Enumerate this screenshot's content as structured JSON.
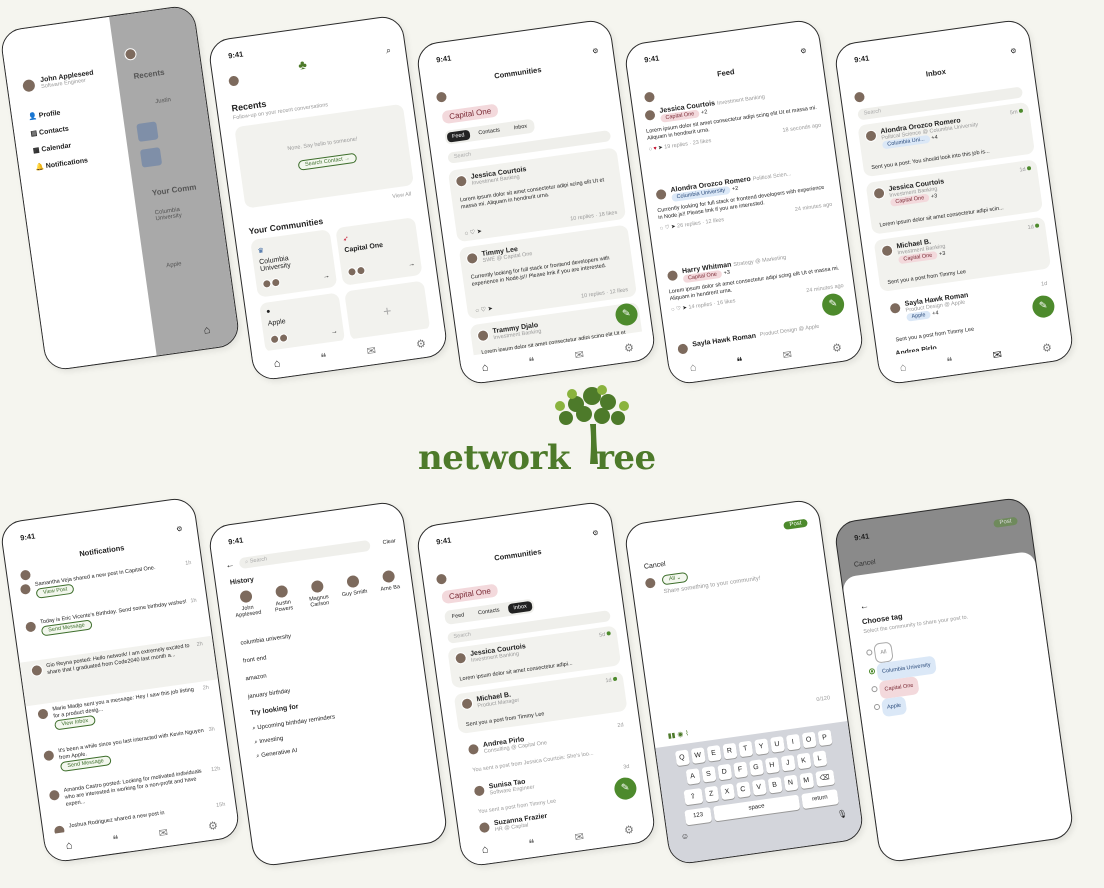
{
  "time": "9:41",
  "brand": {
    "name_left": "network",
    "name_right": "ree",
    "accent": "#4d7a2a"
  },
  "menu": {
    "user": "John Appleseed",
    "role": "Software Engineer",
    "items": [
      "Profile",
      "Contacts",
      "Calendar",
      "Notifications"
    ],
    "behind": [
      "Recents",
      "Justin",
      "Your Comm",
      "Columbia University",
      "Apple"
    ]
  },
  "home": {
    "recents_title": "Recents",
    "recents_sub": "Follow-up on your recent conversations",
    "empty_text": "None. Say hello to someone!",
    "search_contact": "Search Contact →",
    "communities_title": "Your Communities",
    "view_all": "View All",
    "communities": [
      "Columbia University",
      "Capital One",
      "Apple"
    ],
    "plus": "+"
  },
  "community_feed": {
    "title": "Communities",
    "chip": "Capital One",
    "tabs": [
      "Feed",
      "Contacts",
      "Inbox"
    ],
    "search": "Search",
    "filter": "Filter",
    "posts": [
      {
        "name": "Jessica Courtois",
        "role": "Investment Banking",
        "body": "Lorem ipsum dolor sit amet consectetur adipi scing elit Ut et massa mi. Aliquam in hendrerit urna.",
        "meta": "10 replies · 18 likes"
      },
      {
        "name": "Timmy Lee",
        "role": "SWE @ Capital One",
        "body": "Currently looking for full stack or frontend developers with experience in Node.js!! Please lmk if you are interested.",
        "meta": "10 replies · 12 likes"
      },
      {
        "name": "Trammy Djalo",
        "role": "Investment Banking",
        "body": "Lorem ipsum dolor sit amet consectetur adipi scing elit Ut et massa mi. Aliquam in hendrerit"
      }
    ]
  },
  "feed": {
    "title": "Feed",
    "posts": [
      {
        "name": "Jessica Courtois",
        "role": "Investment Banking",
        "tag": "Capital One",
        "more": "+2",
        "body": "Lorem ipsum dolor sit amet consectetur adipi scing elit Ut et massa mi. Aliquam in hendrerit urna.",
        "meta": "19 replies · 23 likes",
        "time": "18 seconds ago"
      },
      {
        "name": "Alondra Orozco Romero",
        "role": "Political Scien...",
        "tag": "Columbia University",
        "more": "+2",
        "body": "Currently looking for full stack or frontend developers with experience in Node.js!! Please lmk if you are interested.",
        "meta": "26 replies · 12 likes",
        "time": "24 minutes ago"
      },
      {
        "name": "Harry Whitman",
        "role": "Strategy @ Marketing",
        "tag": "Capital One",
        "more": "+3",
        "body": "Lorem ipsum dolor sit amet consectetur adipi scing elit Ut et massa mi. Aliquam in hendrerit urna.",
        "meta": "14 replies · 16 likes",
        "time": "24 minutes ago"
      },
      {
        "name": "Sayla Hawk Roman",
        "role": "Product Design @ Apple"
      }
    ]
  },
  "inbox": {
    "title": "Inbox",
    "search": "Search",
    "items": [
      {
        "name": "Alondra Orozco Romero",
        "role": "Political Science @ Columbia University",
        "tag": "Columbia Uni...",
        "more": "+4",
        "msg": "Sent you a post: You should look into this job is...",
        "time": "5m"
      },
      {
        "name": "Jessica Courtois",
        "role": "Investment Banking",
        "tag": "Capital One",
        "more": "+3",
        "msg": "Lorem ipsum dolor sit amet consectetur adipi scin...",
        "time": "1d"
      },
      {
        "name": "Michael B.",
        "role": "Investment Banking",
        "tag": "Capital One",
        "more": "+3",
        "msg": "Sent you a post from Timmy Lee",
        "time": "1d"
      },
      {
        "name": "Sayla Hawk Roman",
        "role": "Product Design @ Apple",
        "tag": "Apple",
        "more": "+4",
        "msg": "Sent you a post from Timmy Lee",
        "time": "1d"
      },
      {
        "name": "Andrea Pirlo"
      }
    ]
  },
  "notifications": {
    "title": "Notifications",
    "items": [
      {
        "text": "Samantha Veja shared a new post in Capital One.",
        "btn": "View Post",
        "time": "1h"
      },
      {
        "text": "Today is Eric Vicente's Birthday. Send some birthday wishes!",
        "btn": "Send Message",
        "time": "1h"
      },
      {
        "text": "Gio Reyna posted: Hello network! I am extremely excited to share that I graduated from Code2040 last month a...",
        "time": "2h"
      },
      {
        "text": "Marie Madjo sent you a message: Hey I saw this job listing for a product desig...",
        "btn": "View Inbox",
        "time": "2h"
      },
      {
        "text": "It's been a while since you last interacted with Kevin Nguyen from Apple.",
        "btn": "Send Message",
        "time": "3h"
      },
      {
        "text": "Amanda Castro posted: Looking for motivated individuals who are interested in working for a non-profit and have experi...",
        "time": "12h"
      },
      {
        "text": "Joshua Rodriguez shared a new post in",
        "time": "15h"
      }
    ]
  },
  "search_screen": {
    "placeholder": "Search",
    "clear": "Clear",
    "history_title": "History",
    "people": [
      "John Appleseed",
      "Austin Powers",
      "Magnus Carlson",
      "Guy Smith",
      "Ame Ba"
    ],
    "history": [
      "columbia university",
      "front end",
      "amazon",
      "january birthday"
    ],
    "try_title": "Try looking for",
    "suggestions": [
      "Upcoming birthday reminders",
      "Investing",
      "Generative AI"
    ]
  },
  "community_inbox": {
    "title": "Communities",
    "chip": "Capital One",
    "tabs": [
      "Feed",
      "Contacts",
      "Inbox"
    ],
    "search": "Search",
    "items": [
      {
        "name": "Jessica Courtois",
        "role": "Investment Banking",
        "msg": "Lorem ipsum dolor sit amet consectetur adipi...",
        "time": "5d"
      },
      {
        "name": "Michael B.",
        "role": "Product Manager",
        "msg": "Sent you a post from Timmy Lee",
        "time": "1d"
      },
      {
        "name": "Andrea Pirlo",
        "role": "Consulting @ Capital One",
        "msg": "You sent a post from Jessica Courtois: She's loo...",
        "time": "2d"
      },
      {
        "name": "Sunisa Tao",
        "role": "Software Engineer",
        "msg": "You sent a post from Timmy Lee",
        "time": "3d"
      },
      {
        "name": "Suzanna Frazier",
        "role": "HR @ Capital"
      }
    ]
  },
  "compose": {
    "cancel": "Cancel",
    "post": "Post",
    "audience": "All",
    "placeholder": "Share something to your community!",
    "counter": "0/120",
    "rows": [
      [
        "Q",
        "W",
        "E",
        "R",
        "T",
        "Y",
        "U",
        "I",
        "O",
        "P"
      ],
      [
        "A",
        "S",
        "D",
        "F",
        "G",
        "H",
        "J",
        "K",
        "L"
      ],
      [
        "Z",
        "X",
        "C",
        "V",
        "B",
        "N",
        "M"
      ]
    ],
    "num": "123",
    "space": "space",
    "return": "return"
  },
  "choose_tag": {
    "cancel": "Cancel",
    "post": "Post",
    "title": "Choose tag",
    "sub": "Select the community to share your post to.",
    "options": [
      "All",
      "Columbia University",
      "Capital One",
      "Apple"
    ]
  }
}
